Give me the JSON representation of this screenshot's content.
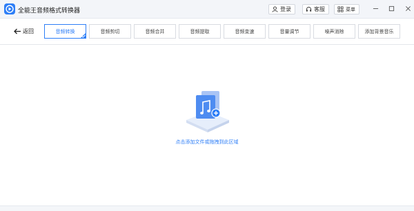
{
  "app": {
    "title": "全能王音频格式转换器",
    "accent_color": "#2d7ef7"
  },
  "titlebar": {
    "login_label": "登录",
    "service_label": "客服",
    "menu_label": "菜单",
    "icons": [
      "user-icon",
      "headset-icon",
      "grid-icon",
      "minimize-icon",
      "maximize-icon",
      "close-icon"
    ]
  },
  "toolbar": {
    "back_label": "返回",
    "tabs": [
      {
        "label": "音频转换",
        "active": true
      },
      {
        "label": "音频剪切",
        "active": false
      },
      {
        "label": "音频合并",
        "active": false
      },
      {
        "label": "音频提取",
        "active": false
      },
      {
        "label": "音频变速",
        "active": false
      },
      {
        "label": "音量调节",
        "active": false
      },
      {
        "label": "噪声消除",
        "active": false
      },
      {
        "label": "添加背景音乐",
        "active": false
      }
    ]
  },
  "dropzone": {
    "hint_part1": "点击添加文件",
    "hint_part2": "或",
    "hint_part3": "拖拽到此区域",
    "icon": "music-file-add-icon"
  }
}
